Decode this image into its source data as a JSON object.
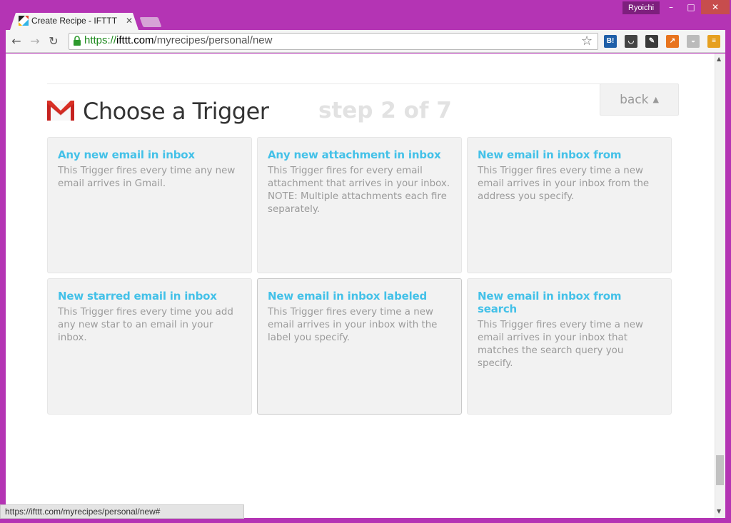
{
  "window": {
    "user_badge": "Ryoichi",
    "min_glyph": "–",
    "max_glyph": "□",
    "close_glyph": "✕"
  },
  "tab": {
    "title": "Create Recipe - IFTTT",
    "close_glyph": "✕"
  },
  "toolbar": {
    "back_glyph": "←",
    "forward_glyph": "→",
    "reload_glyph": "↻",
    "url_scheme": "https://",
    "url_host": "ifttt.com",
    "url_path": "/myrecipes/personal/new",
    "star_glyph": "☆",
    "extensions": [
      {
        "name": "hatena-bookmark-icon",
        "label": "B!",
        "color": "#1f5fa8"
      },
      {
        "name": "pocket-icon",
        "label": "◡",
        "color": "#444444"
      },
      {
        "name": "evernote-icon",
        "label": "✎",
        "color": "#3a3a3a"
      },
      {
        "name": "analytics-icon",
        "label": "↗",
        "color": "#e8741e"
      },
      {
        "name": "cup-icon",
        "label": "◒",
        "color": "#bbbbbb"
      },
      {
        "name": "menu-icon",
        "label": "≡",
        "color": "#e6a020"
      }
    ]
  },
  "page": {
    "title": "Choose a Trigger",
    "step": "step 2 of 7",
    "back_label": "back",
    "back_caret": "▲"
  },
  "triggers": [
    {
      "title": "Any new email in inbox",
      "description": "This Trigger fires every time any new email arrives in Gmail."
    },
    {
      "title": "Any new attachment in inbox",
      "description": "This Trigger fires for every email attachment that arrives in your inbox. NOTE: Multiple attachments each fire separately."
    },
    {
      "title": "New email in inbox from",
      "description": "This Trigger fires every time a new email arrives in your inbox from the address you specify."
    },
    {
      "title": "New starred email in inbox",
      "description": "This Trigger fires every time you add any new star to an email in your inbox."
    },
    {
      "title": "New email in inbox labeled",
      "description": "This Trigger fires every time a new email arrives in your inbox with the label you specify."
    },
    {
      "title": "New email in inbox from search",
      "description": "This Trigger fires every time a new email arrives in your inbox that matches the search query you specify."
    }
  ],
  "status_bar": {
    "text": "https://ifttt.com/myrecipes/personal/new#"
  },
  "colors": {
    "frame": "#b434b4",
    "accent_title": "#44c1e8",
    "card_bg": "#f2f2f2"
  }
}
